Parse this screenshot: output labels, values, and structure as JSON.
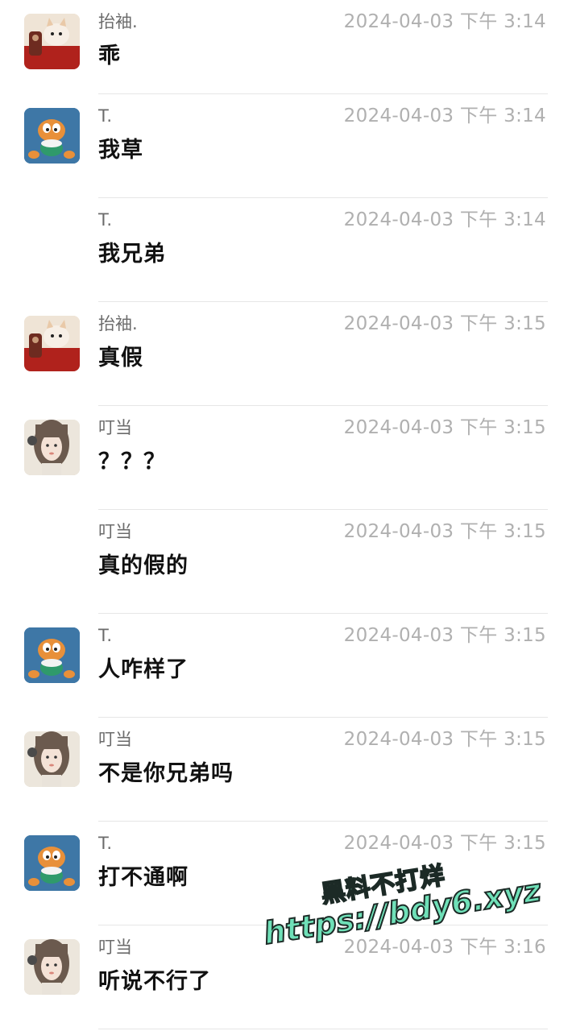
{
  "messages": [
    {
      "sender": "抬袖.",
      "time": "2024-04-03 下午 3:14",
      "text": "乖",
      "avatar": "cat-avatar",
      "show_avatar": true
    },
    {
      "sender": "T.",
      "time": "2024-04-03 下午 3:14",
      "text": "我草",
      "avatar": "garfield-avatar",
      "show_avatar": true
    },
    {
      "sender": "T.",
      "time": "2024-04-03 下午 3:14",
      "text": "我兄弟",
      "avatar": "",
      "show_avatar": false
    },
    {
      "sender": "抬袖.",
      "time": "2024-04-03 下午 3:15",
      "text": "真假",
      "avatar": "cat-avatar",
      "show_avatar": true
    },
    {
      "sender": "叮当",
      "time": "2024-04-03 下午 3:15",
      "text": "？？？",
      "avatar": "girl-avatar",
      "show_avatar": true
    },
    {
      "sender": "叮当",
      "time": "2024-04-03 下午 3:15",
      "text": "真的假的",
      "avatar": "",
      "show_avatar": false
    },
    {
      "sender": "T.",
      "time": "2024-04-03 下午 3:15",
      "text": "人咋样了",
      "avatar": "garfield-avatar",
      "show_avatar": true
    },
    {
      "sender": "叮当",
      "time": "2024-04-03 下午 3:15",
      "text": "不是你兄弟吗",
      "avatar": "girl-avatar",
      "show_avatar": true
    },
    {
      "sender": "T.",
      "time": "2024-04-03 下午 3:15",
      "text": "打不通啊",
      "avatar": "garfield-avatar",
      "show_avatar": true
    },
    {
      "sender": "叮当",
      "time": "2024-04-03 下午 3:16",
      "text": "听说不行了",
      "avatar": "girl-avatar",
      "show_avatar": true
    }
  ],
  "watermark": {
    "line1": "黑料不打烊",
    "line2": "https://bdy6.xyz"
  },
  "colors": {
    "sender": "#6b6b6b",
    "time": "#b0b0b0",
    "text": "#111111",
    "divider": "#e6e6e6",
    "watermark": "#6fe0b8"
  }
}
